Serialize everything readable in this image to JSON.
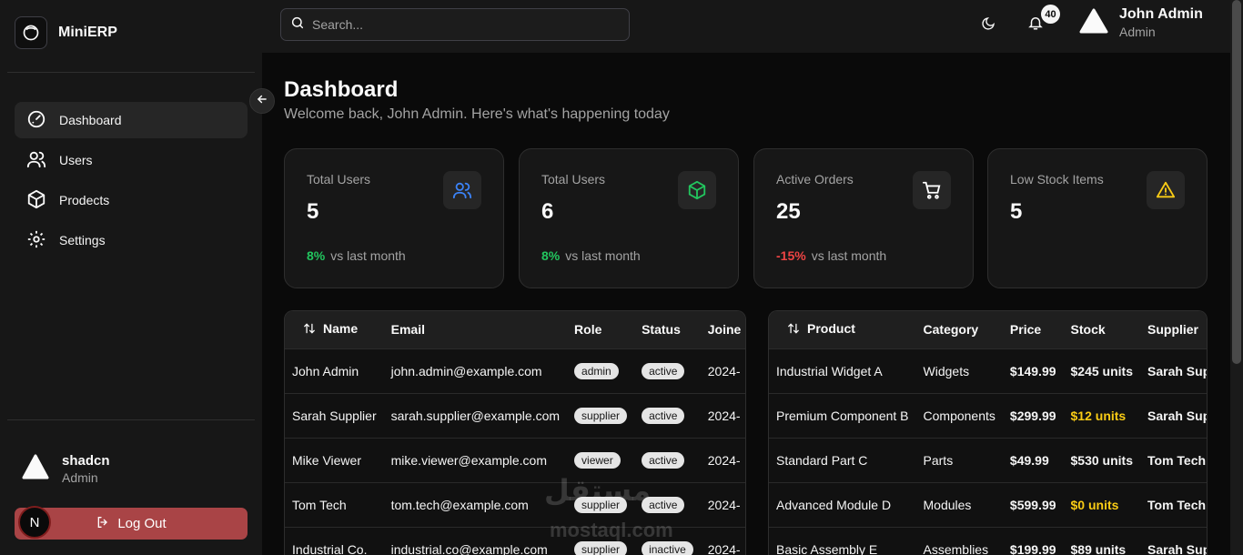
{
  "brand": {
    "name": "MiniERP"
  },
  "sidebar": {
    "items": [
      {
        "label": "Dashboard",
        "icon": "gauge-icon",
        "active": true
      },
      {
        "label": "Users",
        "icon": "users-icon"
      },
      {
        "label": "Prodects",
        "icon": "box-icon"
      },
      {
        "label": "Settings",
        "icon": "gear-icon"
      }
    ],
    "user": {
      "name": "shadcn",
      "role": "Admin"
    },
    "logout_label": "Log Out",
    "badge_letter": "N"
  },
  "header": {
    "search_placeholder": "Search...",
    "notifications_count": "40",
    "user": {
      "name": "John Admin",
      "role": "Admin"
    }
  },
  "page": {
    "title": "Dashboard",
    "subtitle": "Welcome back, John Admin. Here's what's happening today"
  },
  "cards": [
    {
      "label": "Total Users",
      "value": "5",
      "trend": "8%",
      "trend_text": "vs last month",
      "trend_color": "#22c55e",
      "icon": "users-icon",
      "icon_color": "#3b82f6"
    },
    {
      "label": "Total Users",
      "value": "6",
      "trend": "8%",
      "trend_text": "vs last month",
      "trend_color": "#22c55e",
      "icon": "box-icon",
      "icon_color": "#22c55e"
    },
    {
      "label": "Active Orders",
      "value": "25",
      "trend": "-15%",
      "trend_text": "vs last month",
      "trend_color": "#ef4444",
      "icon": "cart-icon",
      "icon_color": "#ffffff"
    },
    {
      "label": "Low Stock Items",
      "value": "5",
      "icon": "alert-icon",
      "icon_color": "#facc15"
    }
  ],
  "users_table": {
    "columns": [
      "Name",
      "Email",
      "Role",
      "Status",
      "Joine"
    ],
    "rows": [
      {
        "name": "John Admin",
        "email": "john.admin@example.com",
        "role": "admin",
        "status": "active",
        "joined": "2024-"
      },
      {
        "name": "Sarah Supplier",
        "email": "sarah.supplier@example.com",
        "role": "supplier",
        "status": "active",
        "joined": "2024-"
      },
      {
        "name": "Mike Viewer",
        "email": "mike.viewer@example.com",
        "role": "viewer",
        "status": "active",
        "joined": "2024-"
      },
      {
        "name": "Tom Tech",
        "email": "tom.tech@example.com",
        "role": "supplier",
        "status": "active",
        "joined": "2024-"
      },
      {
        "name": "Industrial Co.",
        "email": "industrial.co@example.com",
        "role": "supplier",
        "status": "inactive",
        "joined": "2024-"
      }
    ]
  },
  "products_table": {
    "columns": [
      "Product",
      "Category",
      "Price",
      "Stock",
      "Supplier"
    ],
    "rows": [
      {
        "product": "Industrial Widget A",
        "category": "Widgets",
        "price": "$149.99",
        "stock": "$245 units",
        "low": false,
        "supplier": "Sarah Sup"
      },
      {
        "product": "Premium Component B",
        "category": "Components",
        "price": "$299.99",
        "stock": "$12 units",
        "low": true,
        "supplier": "Sarah Sup"
      },
      {
        "product": "Standard Part C",
        "category": "Parts",
        "price": "$49.99",
        "stock": "$530 units",
        "low": false,
        "supplier": "Tom Tech"
      },
      {
        "product": "Advanced Module D",
        "category": "Modules",
        "price": "$599.99",
        "stock": "$0 units",
        "low": true,
        "supplier": "Tom Tech"
      },
      {
        "product": "Basic Assembly E",
        "category": "Assemblies",
        "price": "$199.99",
        "stock": "$89 units",
        "low": false,
        "supplier": "Sarah Sup"
      }
    ]
  },
  "watermark": {
    "logo_text": "مستقل",
    "domain": "mostaql.com"
  }
}
